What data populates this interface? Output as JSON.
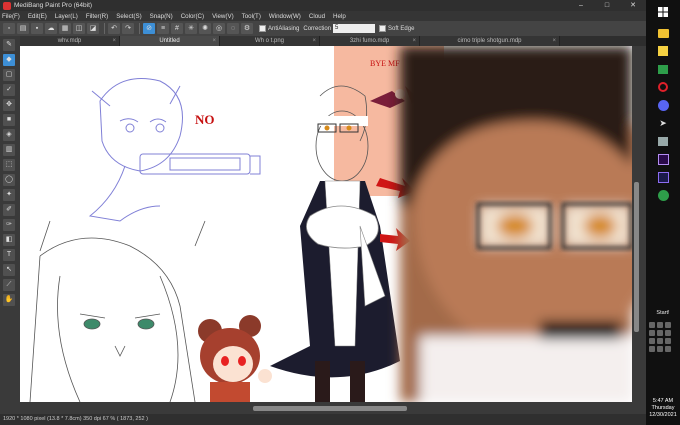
{
  "window": {
    "title": "MediBang Paint Pro (64bit)",
    "controls": [
      "–",
      "□",
      "✕"
    ]
  },
  "menu": [
    "File(F)",
    "Edit(E)",
    "Layer(L)",
    "Filter(R)",
    "Select(S)",
    "Snap(N)",
    "Color(C)",
    "View(V)",
    "Tool(T)",
    "Window(W)",
    "Cloud",
    "Help"
  ],
  "toolbar": {
    "antialiasing_label": "AntiAliasing",
    "correction_label": "Correction",
    "correction_value": "5",
    "soft_edge_label": "Soft Edge"
  },
  "tabs": [
    {
      "label": "whv.mdp",
      "active": false
    },
    {
      "label": "Untitled",
      "active": true
    },
    {
      "label": "Wh o t.png",
      "active": false
    },
    {
      "label": "3zhi fumo.mdp",
      "active": false
    },
    {
      "label": "cirno triple shotgun.mdp",
      "active": false
    }
  ],
  "canvas": {
    "text_no": "NO",
    "text_bye": "BYE MF"
  },
  "status": {
    "text": "1920 * 1080 pixel  (13.8 * 7.8cm)  350 dpi  67 %  ( 1873, 252 )"
  },
  "taskbar": {
    "start_label": "Start!",
    "time": "5:47 AM",
    "day": "Thursday",
    "date": "12/30/2021"
  },
  "colors": {
    "accent": "#3d8fd6",
    "red_annotation": "#cc1111",
    "peach_bg": "#f6b9a0"
  }
}
